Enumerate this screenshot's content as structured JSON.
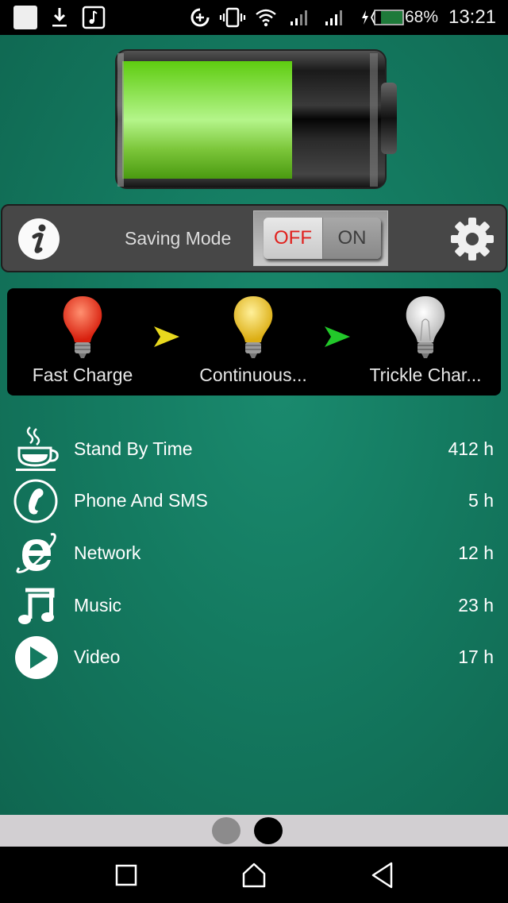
{
  "status_bar": {
    "left_icons": [
      "notification-square-icon",
      "download-icon",
      "music-note-icon"
    ],
    "right_icons": [
      "data-saver-icon",
      "vibrate-icon",
      "wifi-icon",
      "signal-1-icon",
      "signal-2-icon",
      "charging-battery-icon"
    ],
    "battery_percent": "68%",
    "battery_level": 0.68,
    "time": "13:21"
  },
  "battery": {
    "icon": "battery-graphic",
    "fill_level": 0.6,
    "fill_color": "#7ad836"
  },
  "saving_mode": {
    "info_icon": "info-icon",
    "label": "Saving Mode",
    "toggle": {
      "off_label": "OFF",
      "on_label": "ON",
      "state": "OFF",
      "off_color": "#e0201c"
    },
    "settings_icon": "gear-icon"
  },
  "charge_stages": [
    {
      "label": "Fast Charge",
      "icon": "lightbulb-red-icon",
      "color": "#e8321e"
    },
    {
      "label": "Continuous...",
      "icon": "lightbulb-yellow-icon",
      "color": "#e8be1e"
    },
    {
      "label": "Trickle Char...",
      "icon": "lightbulb-white-icon",
      "color": "#e4e4e4"
    }
  ],
  "stage_arrows": [
    {
      "icon": "arrow-right-yellow-icon",
      "color": "#e8d81e"
    },
    {
      "icon": "arrow-right-green-icon",
      "color": "#22c82a"
    }
  ],
  "usage": [
    {
      "label": "Stand By Time",
      "value": "412 h",
      "icon": "coffee-cup-icon"
    },
    {
      "label": "Phone And SMS",
      "value": "5 h",
      "icon": "phone-icon"
    },
    {
      "label": "Network",
      "value": "12 h",
      "icon": "browser-e-icon"
    },
    {
      "label": "Music",
      "value": "23 h",
      "icon": "music-note-icon"
    },
    {
      "label": "Video",
      "value": "17 h",
      "icon": "play-icon"
    }
  ],
  "pager": {
    "pages": 2,
    "active_index": 1
  },
  "nav_bar": {
    "buttons": [
      "recents-icon",
      "home-icon",
      "back-icon"
    ]
  },
  "colors": {
    "background": "#147a60",
    "panel": "#474747",
    "stages_panel": "#000000"
  }
}
